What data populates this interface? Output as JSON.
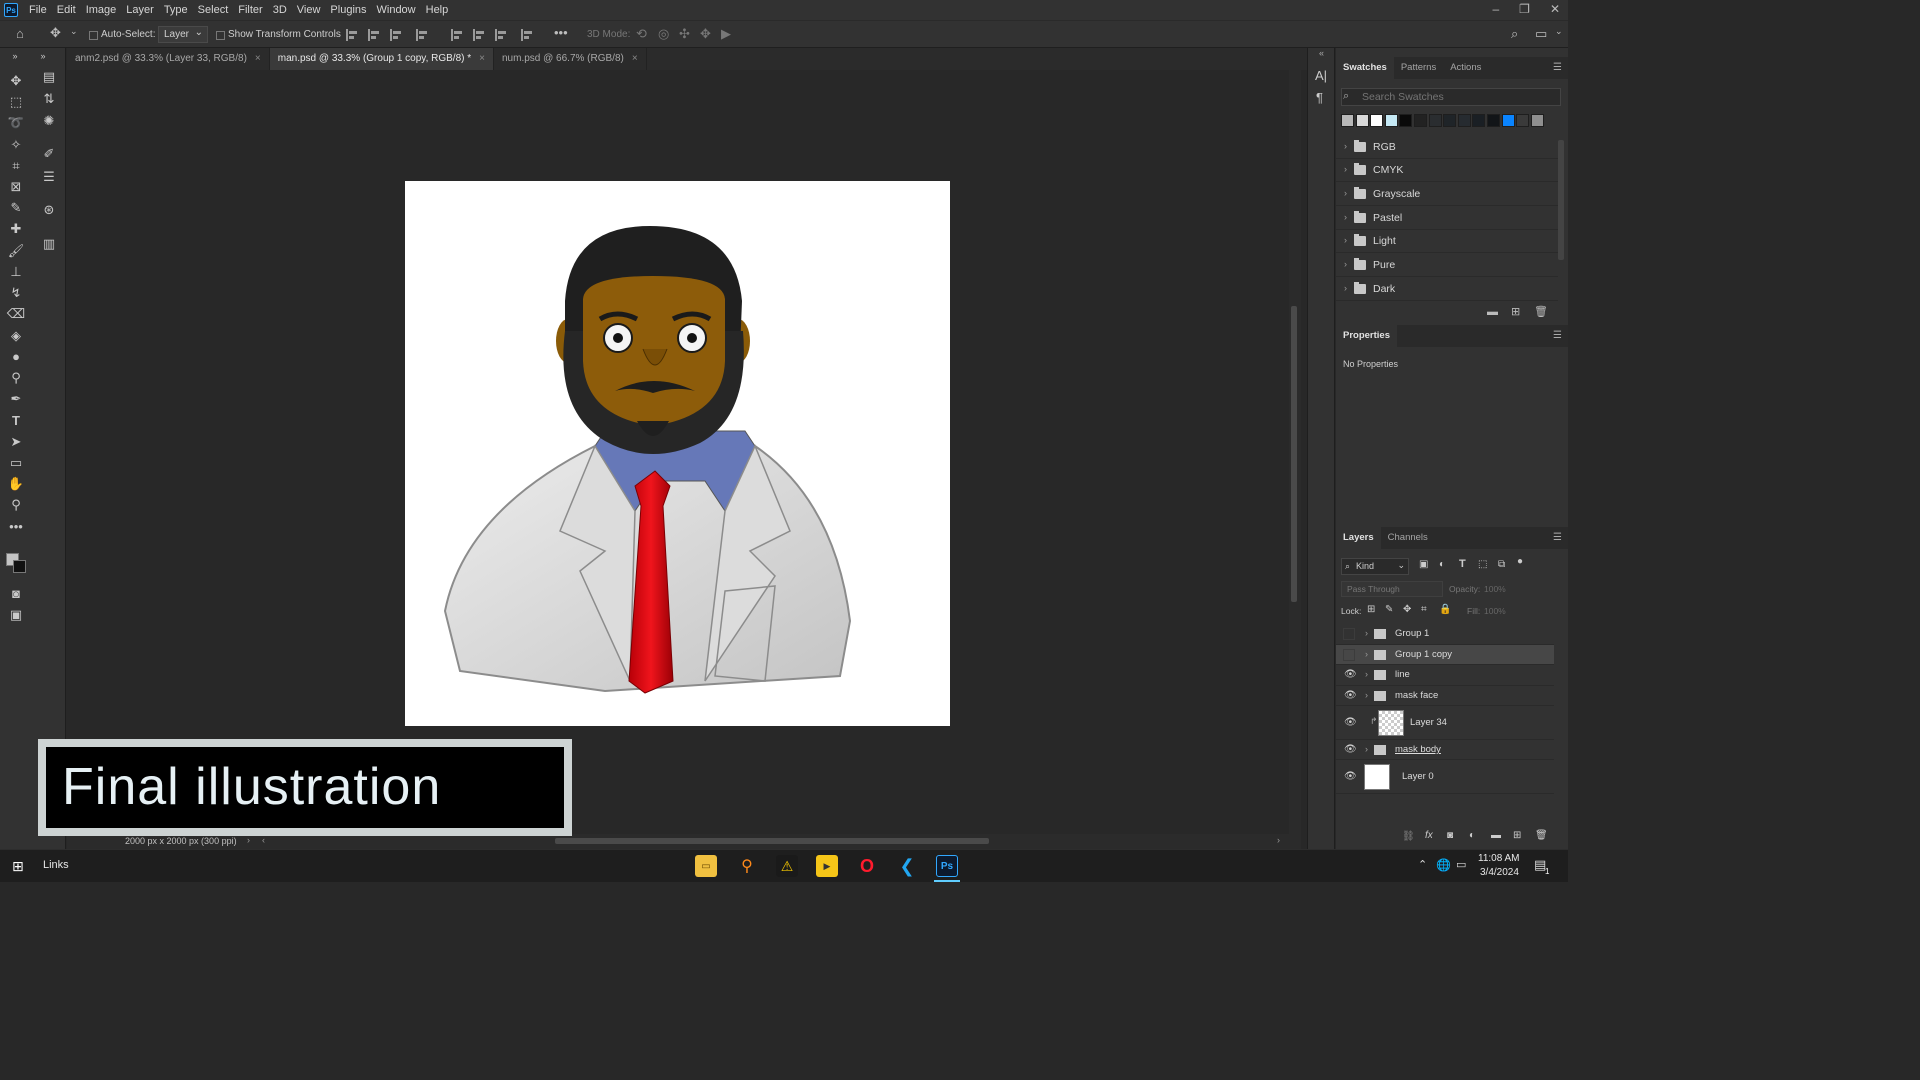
{
  "menubar": {
    "logo": "Ps",
    "items": [
      "File",
      "Edit",
      "Image",
      "Layer",
      "Type",
      "Select",
      "Filter",
      "3D",
      "View",
      "Plugins",
      "Window",
      "Help"
    ]
  },
  "options": {
    "auto_select_label": "Auto-Select:",
    "auto_select_value": "Layer",
    "transform_label": "Show Transform Controls",
    "mode_3d": "3D Mode:"
  },
  "tabs": [
    {
      "label": "anm2.psd @ 33.3% (Layer 33, RGB/8)",
      "active": false
    },
    {
      "label": "man.psd @ 33.3% (Group 1 copy, RGB/8) *",
      "active": true
    },
    {
      "label": "num.psd @ 66.7% (RGB/8)",
      "active": false
    }
  ],
  "tab_close": "×",
  "status": {
    "doc_info": "2000 px x 2000 px (300 ppi)"
  },
  "caption": {
    "text": "Final illustration"
  },
  "swatches_panel": {
    "tabs": [
      "Swatches",
      "Patterns",
      "Actions"
    ],
    "search_placeholder": "Search Swatches",
    "colors": [
      "#b8b8b8",
      "#d9d9d9",
      "#ffffff",
      "#c5e9f5",
      "#0a0a0a",
      "#222222",
      "#2a2d30",
      "#1f2428",
      "#262b30",
      "#1a1f24",
      "#121518",
      "#0a84ff",
      "#3a3a3a",
      "#8f8f8f"
    ],
    "folders": [
      "RGB",
      "CMYK",
      "Grayscale",
      "Pastel",
      "Light",
      "Pure",
      "Dark"
    ]
  },
  "properties_panel": {
    "title": "Properties",
    "content": "No Properties"
  },
  "layers_panel": {
    "tabs": [
      "Layers",
      "Channels"
    ],
    "filter_kind": "Kind",
    "blend_mode": "Pass Through",
    "opacity_label": "Opacity:",
    "opacity_value": "100%",
    "lock_label": "Lock:",
    "fill_label": "Fill:",
    "fill_value": "100%",
    "layers": [
      {
        "name": "Group 1",
        "type": "group",
        "visible": false,
        "selected": false
      },
      {
        "name": "Group 1 copy",
        "type": "group",
        "visible": false,
        "selected": true
      },
      {
        "name": "line",
        "type": "group",
        "visible": true,
        "selected": false
      },
      {
        "name": "mask face",
        "type": "group",
        "visible": true,
        "selected": false
      },
      {
        "name": "Layer 34",
        "type": "pixel",
        "visible": true,
        "selected": false
      },
      {
        "name": "mask body",
        "type": "group",
        "visible": true,
        "selected": false
      },
      {
        "name": "Layer 0",
        "type": "pixel",
        "visible": true,
        "selected": false
      }
    ]
  },
  "taskbar": {
    "links_label": "Links",
    "time": "11:08 AM",
    "date": "3/4/2024",
    "notification_count": "1"
  }
}
